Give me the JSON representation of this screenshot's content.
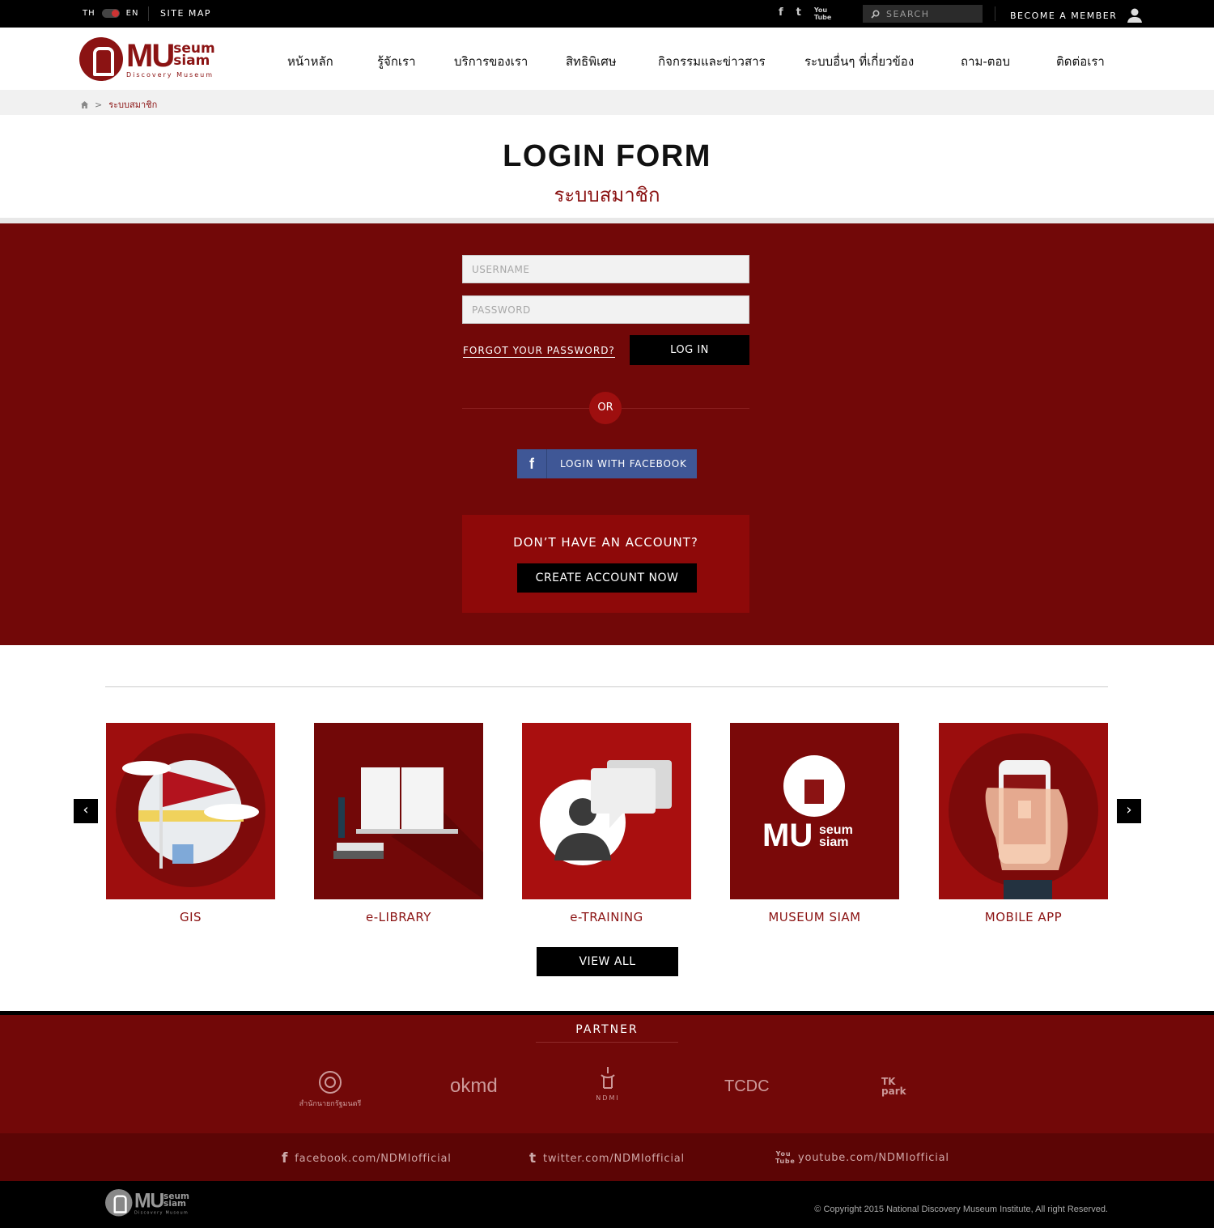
{
  "topbar": {
    "lang_th": "TH",
    "lang_en": "EN",
    "site_map": "SITE MAP",
    "social": [
      "f",
      "t",
      "You Tube"
    ],
    "search_placeholder": "SEARCH",
    "member": "BECOME A MEMBER"
  },
  "logo": {
    "mu": "MU",
    "line1": "seum",
    "line2": "siam",
    "tagline": "Discovery Museum"
  },
  "nav": [
    "หน้าหลัก",
    "รู้จักเรา",
    "บริการของเรา",
    "สิทธิพิเศษ",
    "กิจกรรมและข่าวสาร",
    "ระบบอื่นๆ ที่เกี่ยวข้อง",
    "ถาม-ตอบ",
    "ติดต่อเรา"
  ],
  "breadcrumb": {
    "current": "ระบบสมาชิก",
    "separator": ">"
  },
  "title": {
    "en": "LOGIN FORM",
    "th": "ระบบสมาชิก"
  },
  "login": {
    "username_placeholder": "USERNAME",
    "password_placeholder": "PASSWORD",
    "forgot": "FORGOT YOUR PASSWORD?",
    "login_button": "LOG IN",
    "or": "OR",
    "facebook_icon": "f",
    "facebook": "LOGIN WITH FACEBOOK",
    "no_account": "DON’T HAVE AN ACCOUNT?",
    "create": "CREATE ACCOUNT NOW"
  },
  "services": {
    "items": [
      {
        "label": "GIS",
        "icon": "map-flag-icon",
        "bg": "#9e0e0e"
      },
      {
        "label": "e-LIBRARY",
        "icon": "book-icon",
        "bg": "#720808"
      },
      {
        "label": "e-TRAINING",
        "icon": "chat-person-icon",
        "bg": "#a90f0f"
      },
      {
        "label": "MUSEUM SIAM",
        "icon": "museum-logo-icon",
        "bg": "#7a0909"
      },
      {
        "label": "MOBILE APP",
        "icon": "phone-icon",
        "bg": "#9b0d0d"
      }
    ],
    "view_all": "VIEW ALL",
    "prev_icon": "chevron-left-icon",
    "next_icon": "chevron-right-icon"
  },
  "partner": {
    "title": "PARTNER",
    "logos": [
      {
        "name": "สำนักนายกรัฐมนตรี"
      },
      {
        "name": "okmd"
      },
      {
        "name": "NDMI"
      },
      {
        "name": "TCDC"
      },
      {
        "name": "TK park"
      }
    ]
  },
  "social_links": [
    {
      "icon": "facebook-icon",
      "glyph": "f",
      "text": "facebook.com/NDMIofficial"
    },
    {
      "icon": "twitter-icon",
      "glyph": "t",
      "text": "twitter.com/NDMIofficial"
    },
    {
      "icon": "youtube-icon",
      "glyph": "You Tube",
      "text": "youtube.com/NDMIofficial"
    }
  ],
  "copyright": "© Copyright 2015 National Discovery Museum Institute, All right Reserved.",
  "colors": {
    "brand_red": "#8b1313",
    "section_red": "#720808",
    "facebook_blue": "#3f5796"
  }
}
